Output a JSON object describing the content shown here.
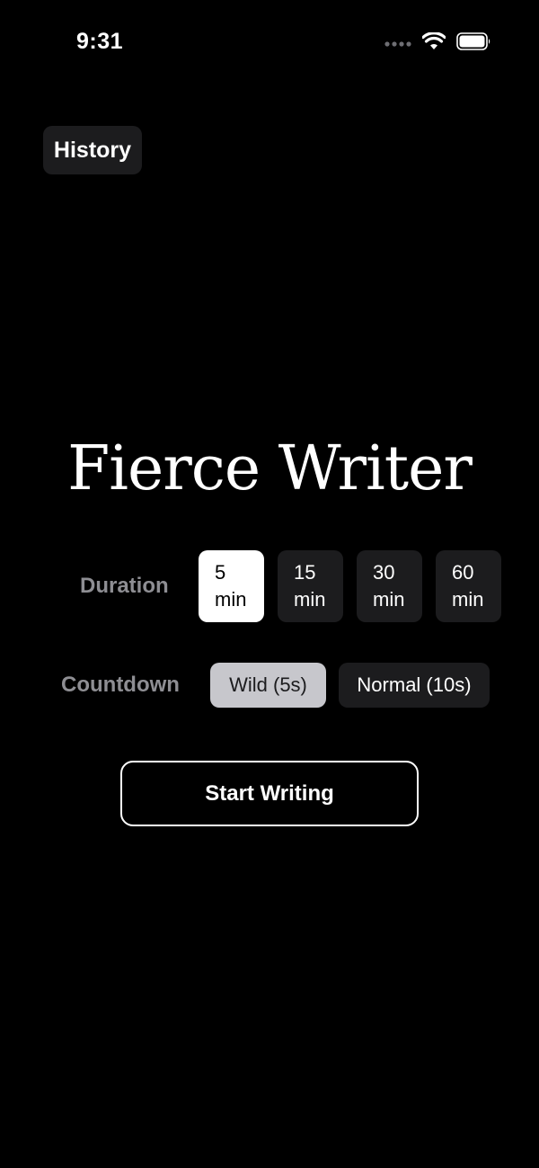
{
  "status_bar": {
    "time": "9:31",
    "icons": [
      "signal-icon",
      "wifi-icon",
      "battery-icon"
    ]
  },
  "header": {
    "history_label": "History"
  },
  "main": {
    "title": "Fierce Writer",
    "duration": {
      "label": "Duration",
      "options": [
        {
          "value": "5",
          "unit": "min"
        },
        {
          "value": "15",
          "unit": "min"
        },
        {
          "value": "30",
          "unit": "min"
        },
        {
          "value": "60",
          "unit": "min"
        }
      ],
      "selected": "5 min"
    },
    "countdown": {
      "label": "Countdown",
      "options": [
        "Wild (5s)",
        "Normal (10s)"
      ],
      "selected": "Wild (5s)"
    },
    "start_label": "Start Writing"
  },
  "colors": {
    "background": "#000000",
    "chip": "#1c1c1e",
    "chip_selected": "#ffffff",
    "countdown_selected": "#c7c7cc",
    "label_gray": "#8e8e93"
  }
}
